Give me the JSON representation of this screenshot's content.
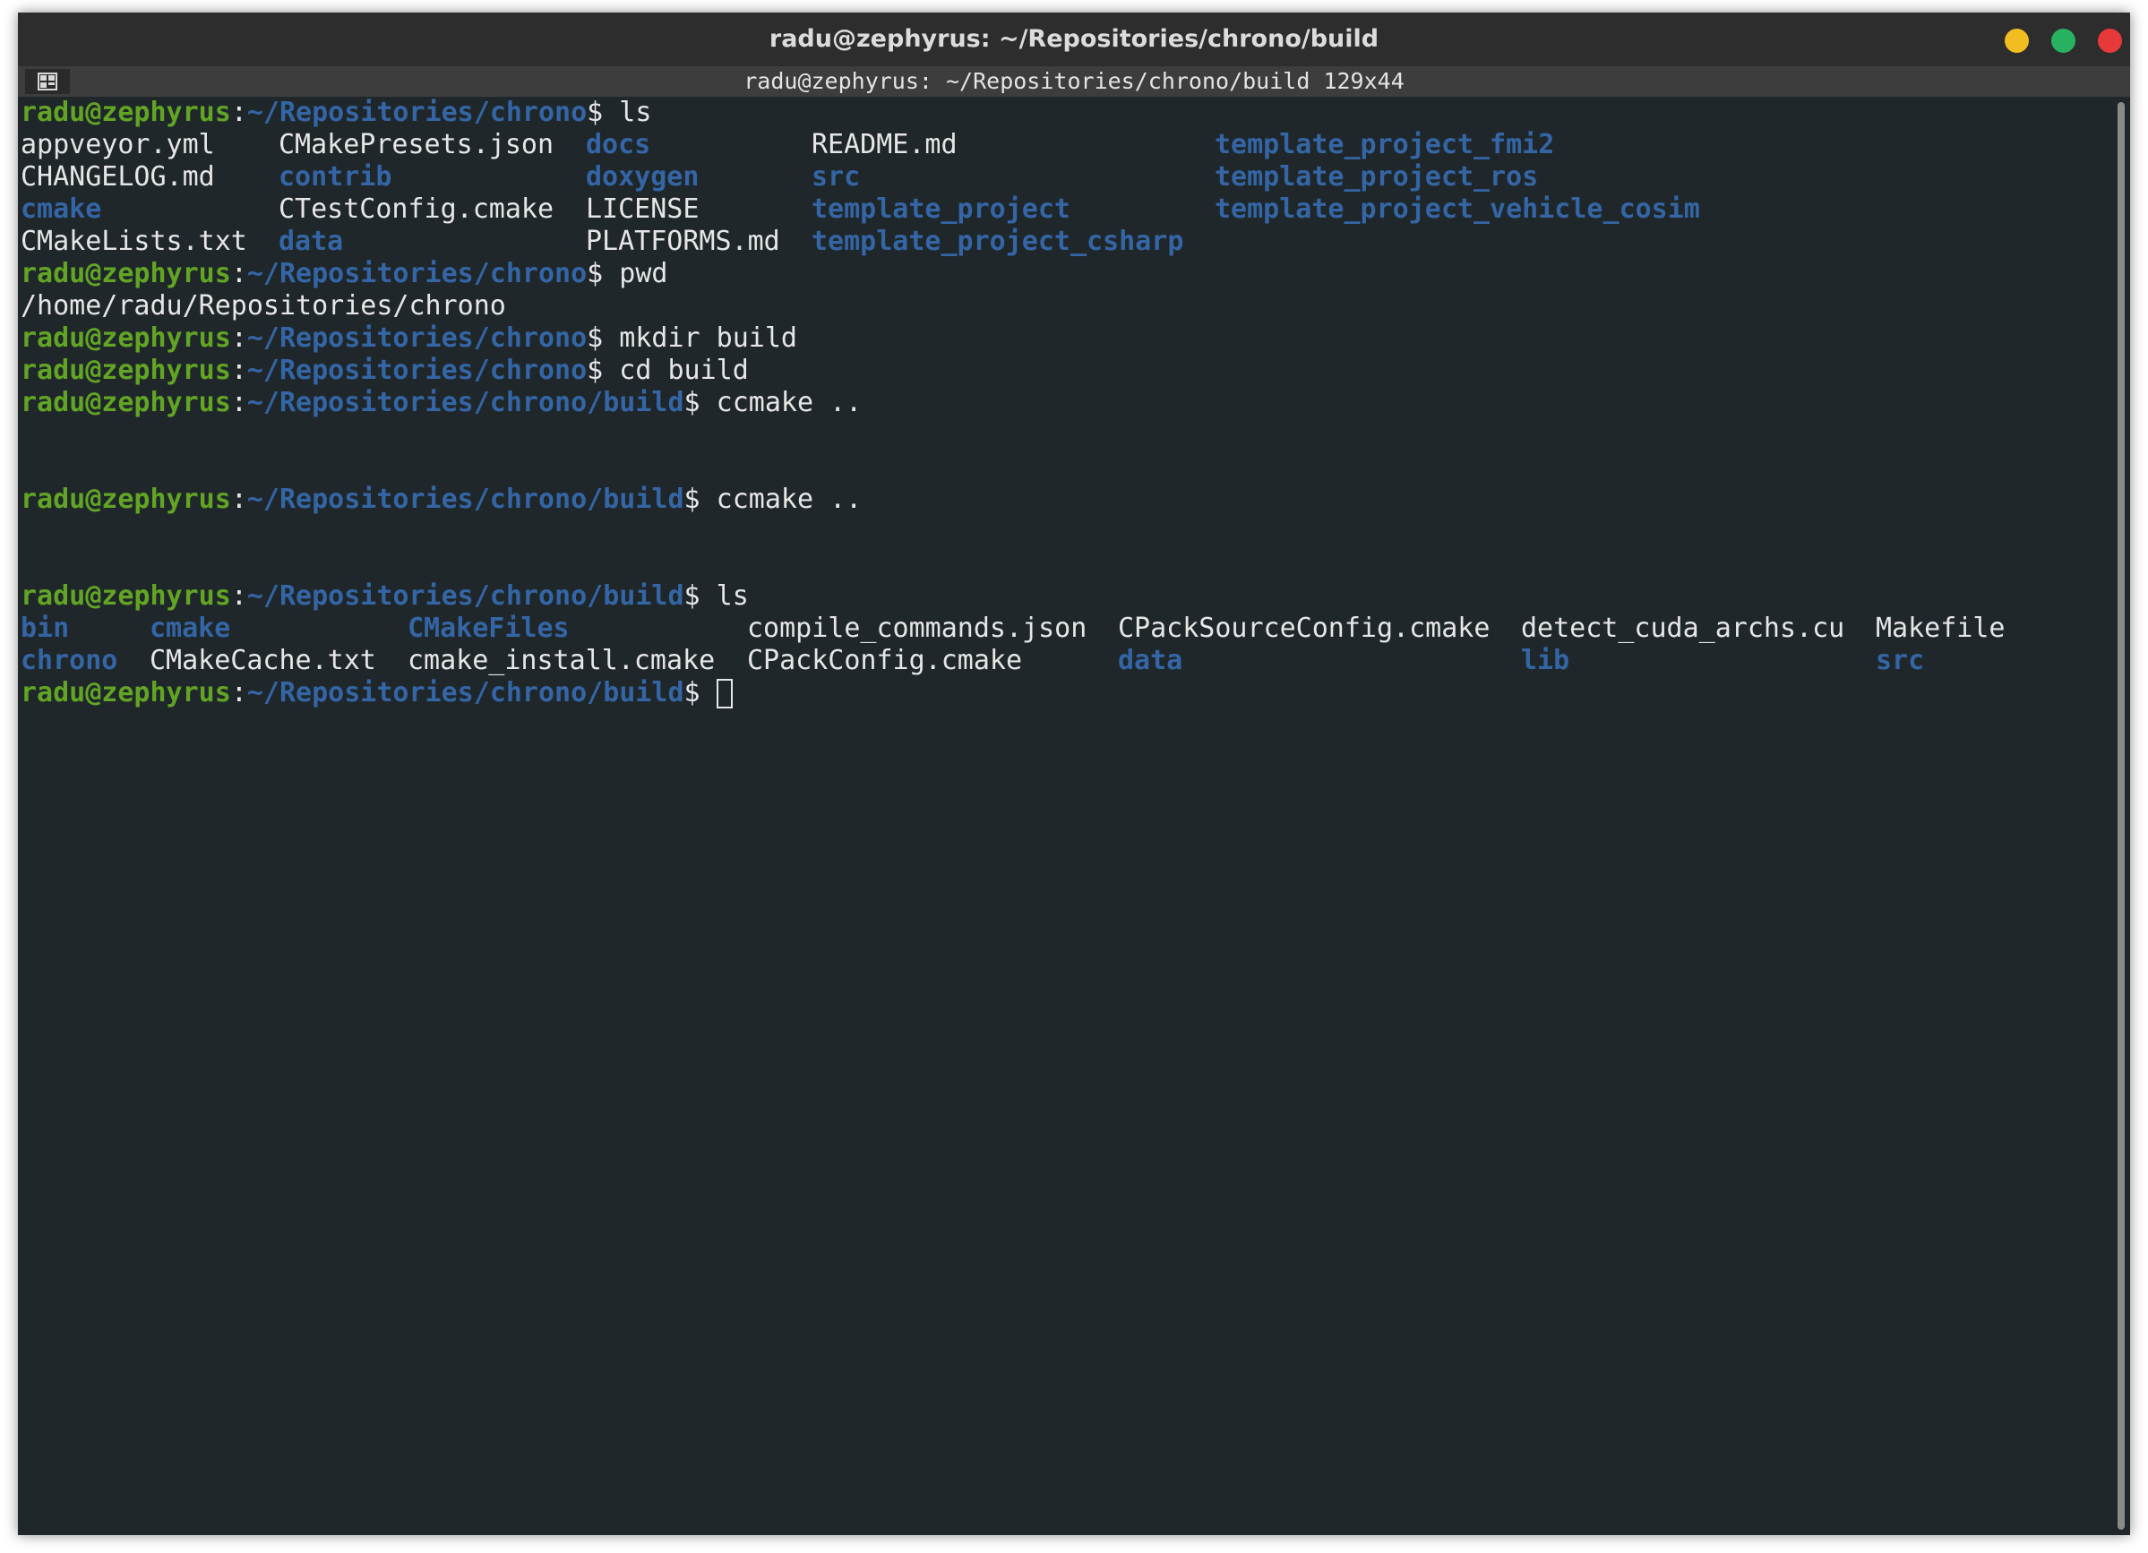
{
  "window": {
    "title": "radu@zephyrus: ~/Repositories/chrono/build",
    "tab_caption": "radu@zephyrus: ~/Repositories/chrono/build 129x44",
    "buttons": {
      "minimize_color": "#f1bd20",
      "maximize_color": "#27b261",
      "close_color": "#e8393a"
    }
  },
  "colors": {
    "background": "#1f272b",
    "user_host": "#62a524",
    "path_and_dirs": "#3465a4",
    "text": "#e6e6e6"
  },
  "prompt": {
    "user_host": "radu@zephyrus",
    "separator": ":",
    "path_repo": "~/Repositories/chrono",
    "path_build": "~/Repositories/chrono/build",
    "symbol": "$"
  },
  "terminal": {
    "cmd_ls": " ls",
    "repo_listing": [
      [
        {
          "text": "appveyor.yml",
          "dir": false
        },
        {
          "text": "CMakePresets.json",
          "dir": false
        },
        {
          "text": "docs",
          "dir": true
        },
        {
          "text": "README.md",
          "dir": false
        },
        {
          "text": "template_project_fmi2",
          "dir": true
        }
      ],
      [
        {
          "text": "CHANGELOG.md",
          "dir": false
        },
        {
          "text": "contrib",
          "dir": true
        },
        {
          "text": "doxygen",
          "dir": true
        },
        {
          "text": "src",
          "dir": true
        },
        {
          "text": "template_project_ros",
          "dir": true
        }
      ],
      [
        {
          "text": "cmake",
          "dir": true
        },
        {
          "text": "CTestConfig.cmake",
          "dir": false
        },
        {
          "text": "LICENSE",
          "dir": false
        },
        {
          "text": "template_project",
          "dir": true
        },
        {
          "text": "template_project_vehicle_cosim",
          "dir": true
        }
      ],
      [
        {
          "text": "CMakeLists.txt",
          "dir": false
        },
        {
          "text": "data",
          "dir": true
        },
        {
          "text": "PLATFORMS.md",
          "dir": false
        },
        {
          "text": "template_project_csharp",
          "dir": true
        },
        {
          "text": "",
          "dir": false
        }
      ]
    ],
    "cmd_pwd": " pwd",
    "pwd_output": "/home/radu/Repositories/chrono",
    "cmd_mkdir": " mkdir build",
    "cmd_cd": " cd build",
    "cmd_ccmake": " ccmake ..",
    "build_listing": [
      [
        {
          "text": "bin",
          "dir": true
        },
        {
          "text": "cmake",
          "dir": true
        },
        {
          "text": "CMakeFiles",
          "dir": true
        },
        {
          "text": "compile_commands.json",
          "dir": false
        },
        {
          "text": "CPackSourceConfig.cmake",
          "dir": false
        },
        {
          "text": "detect_cuda_archs.cu",
          "dir": false
        },
        {
          "text": "Makefile",
          "dir": false
        }
      ],
      [
        {
          "text": "chrono",
          "dir": true
        },
        {
          "text": "CMakeCache.txt",
          "dir": false
        },
        {
          "text": "cmake_install.cmake",
          "dir": false
        },
        {
          "text": "CPackConfig.cmake",
          "dir": false
        },
        {
          "text": "data",
          "dir": true
        },
        {
          "text": "lib",
          "dir": true
        },
        {
          "text": "src",
          "dir": true
        }
      ]
    ]
  }
}
